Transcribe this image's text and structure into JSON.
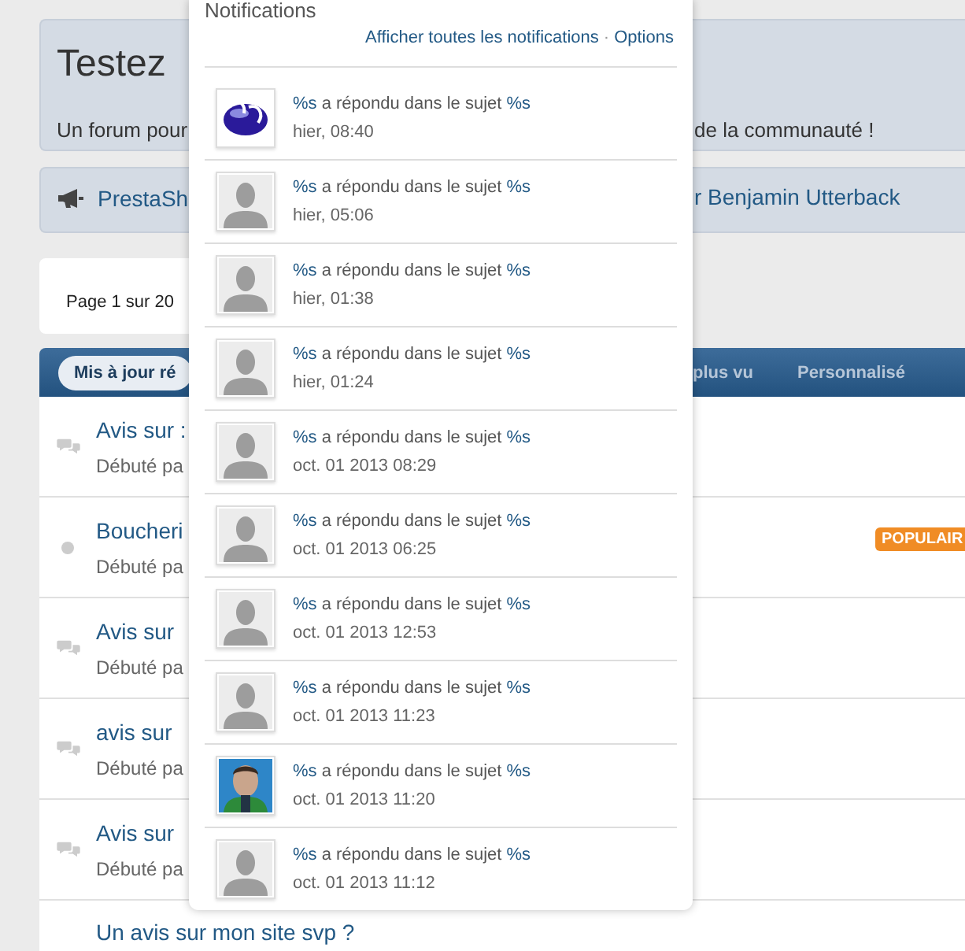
{
  "header": {
    "title": "Testez",
    "description_left": "Un forum pour",
    "description_right": "de la communauté !"
  },
  "announcement": {
    "left": "PrestaSh",
    "right": "r Benjamin Utterback"
  },
  "pagination": {
    "label": "Page 1 sur 20"
  },
  "sort_tabs": [
    {
      "label": "Mis à jour ré",
      "selected": true
    },
    {
      "label": "plus vu",
      "selected": false
    },
    {
      "label": "Personnalisé",
      "selected": false
    }
  ],
  "topics": [
    {
      "title": "Avis sur :",
      "meta": "Débuté pa",
      "kind": "replies"
    },
    {
      "title": "Boucheri",
      "meta": "Débuté pa",
      "kind": "dot",
      "badge": "POPULAIR"
    },
    {
      "title": "Avis sur",
      "meta": "Débuté pa",
      "kind": "replies"
    },
    {
      "title": "avis sur",
      "meta": "Débuté pa",
      "kind": "replies"
    },
    {
      "title": "Avis sur",
      "meta": "Débuté pa",
      "kind": "replies"
    },
    {
      "title": "Un avis sur mon site svp ?",
      "kind": "none"
    }
  ],
  "notifications": {
    "title": "Notifications",
    "links": [
      "Afficher toutes les notifications",
      "Options"
    ],
    "separator": "·",
    "items": [
      {
        "kind": "logo",
        "actor": "%s",
        "text": "a répondu dans le sujet",
        "topic": "%s",
        "time": "hier, 08:40"
      },
      {
        "kind": "default",
        "actor": "%s",
        "text": "a répondu dans le sujet",
        "topic": "%s",
        "time": "hier, 05:06"
      },
      {
        "kind": "default",
        "actor": "%s",
        "text": "a répondu dans le sujet",
        "topic": "%s",
        "time": "hier, 01:38"
      },
      {
        "kind": "default",
        "actor": "%s",
        "text": "a répondu dans le sujet",
        "topic": "%s",
        "time": "hier, 01:24"
      },
      {
        "kind": "default",
        "actor": "%s",
        "text": "a répondu dans le sujet",
        "topic": "%s",
        "time": "oct. 01 2013 08:29"
      },
      {
        "kind": "default",
        "actor": "%s",
        "text": "a répondu dans le sujet",
        "topic": "%s",
        "time": "oct. 01 2013 06:25"
      },
      {
        "kind": "default",
        "actor": "%s",
        "text": "a répondu dans le sujet",
        "topic": "%s",
        "time": "oct. 01 2013 12:53"
      },
      {
        "kind": "default",
        "actor": "%s",
        "text": "a répondu dans le sujet",
        "topic": "%s",
        "time": "oct. 01 2013 11:23"
      },
      {
        "actor": "%s",
        "text": "a répondu dans le sujet",
        "topic": "%s",
        "time": "oct. 01 2013 11:20"
      },
      {
        "kind": "default",
        "actor": "%s",
        "text": "a répondu dans le sujet",
        "topic": "%s",
        "time": "oct. 01 2013 11:12"
      }
    ]
  }
}
